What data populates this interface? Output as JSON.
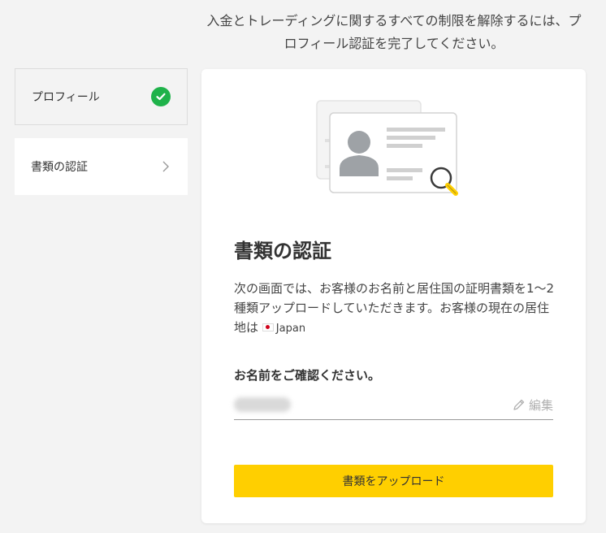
{
  "top_message": "入金とトレーディングに関するすべての制限を解除するには、プロフィール認証を完了してください。",
  "steps": [
    {
      "label": "プロフィール",
      "status_icon": "check-circle-icon"
    },
    {
      "label": "書類の認証",
      "status_icon": "chevron-right-icon"
    }
  ],
  "card": {
    "title": "書類の認証",
    "description": "次の画面では、お客様のお名前と居住国の証明書類を1〜2種類アップロードしていただきます。お客様の現在の居住地は",
    "country": "Japan",
    "name_label": "お名前をご確認ください。",
    "edit_label": "編集",
    "upload_label": "書類をアップロード"
  },
  "colors": {
    "accent": "#ffcf00",
    "success": "#1fb24a",
    "background": "#f3f3f3"
  }
}
